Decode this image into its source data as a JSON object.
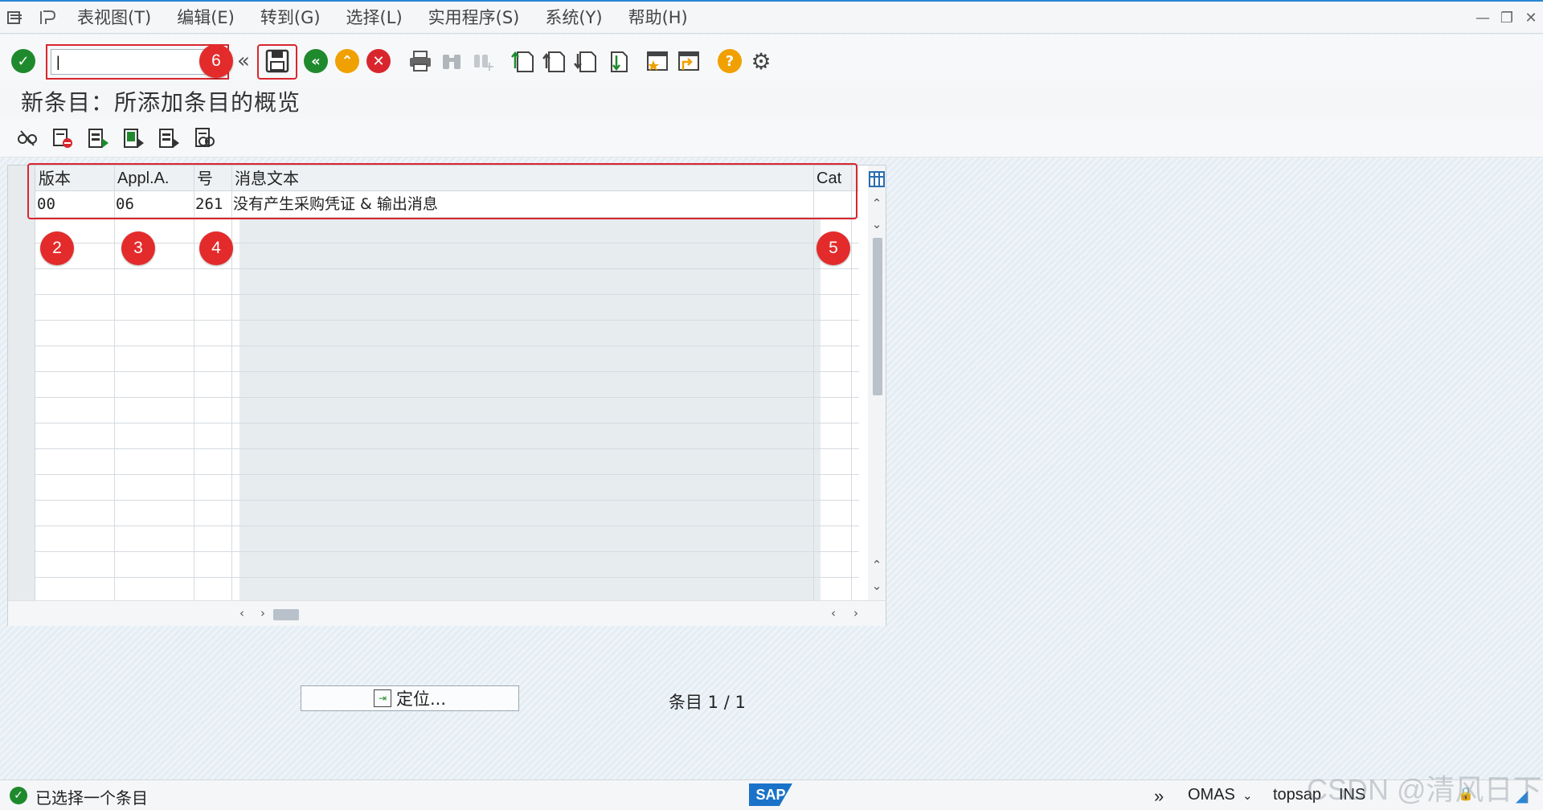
{
  "menu": {
    "items": [
      "表视图(T)",
      "编辑(E)",
      "转到(G)",
      "选择(L)",
      "实用程序(S)",
      "系统(Y)",
      "帮助(H)"
    ]
  },
  "toolbar": {
    "command_value": "|",
    "badge_command": "6"
  },
  "page": {
    "title": "新条目：所添加条目的概览"
  },
  "table": {
    "columns": [
      "版本",
      "Appl.A.",
      "号",
      "消息文本",
      "Cat"
    ],
    "rows": [
      {
        "version": "00",
        "appl": "06",
        "number": "261",
        "text": "没有产生采购凭证 & 输出消息",
        "cat": ""
      }
    ],
    "badges": [
      "2",
      "3",
      "4",
      "5"
    ]
  },
  "bottom": {
    "position_button": "定位...",
    "entry_count": "条目 1 / 1"
  },
  "status": {
    "message": "已选择一个条目",
    "logo": "SAP",
    "system": "OMAS",
    "server": "topsap",
    "mode": "INS"
  },
  "watermark": "CSDN @清风日下",
  "colors": {
    "accent": "#2a86d6",
    "highlight": "#d9262e",
    "ok_green": "#1f8a2d",
    "warn_orange": "#f0a000",
    "cancel_red": "#d9262e"
  }
}
